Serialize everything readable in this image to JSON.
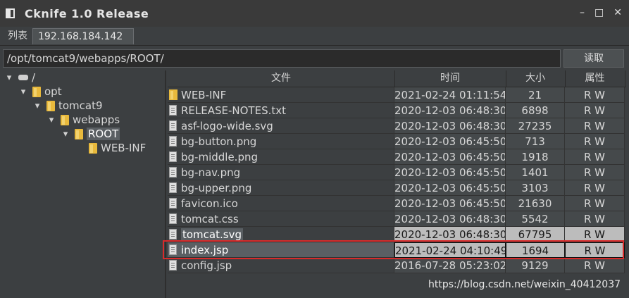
{
  "window": {
    "title": "Cknife 1.0 Release",
    "controls": [
      "–",
      "□",
      "✕"
    ]
  },
  "tabs": [
    {
      "label": "列表"
    },
    {
      "label": "192.168.184.142"
    }
  ],
  "path": {
    "value": "/opt/tomcat9/webapps/ROOT/"
  },
  "read_button": {
    "label": "读取"
  },
  "tree": [
    {
      "label": "/",
      "toggle": "▾",
      "icon": "drive"
    },
    {
      "label": "opt",
      "toggle": "▾",
      "icon": "folder"
    },
    {
      "label": "tomcat9",
      "toggle": "▾",
      "icon": "folder"
    },
    {
      "label": "webapps",
      "toggle": "▾",
      "icon": "folder"
    },
    {
      "label": "ROOT",
      "toggle": "▾",
      "icon": "folder",
      "selected": true
    },
    {
      "label": "WEB-INF",
      "toggle": "",
      "icon": "folder"
    }
  ],
  "table": {
    "headers": [
      "文件",
      "时间",
      "大小",
      "属性"
    ],
    "rows": [
      {
        "name": "WEB-INF",
        "time": "2021-02-24 01:11:54",
        "size": "21",
        "attr": "R W",
        "type": "folder"
      },
      {
        "name": "RELEASE-NOTES.txt",
        "time": "2020-12-03 06:48:30",
        "size": "6898",
        "attr": "R W",
        "type": "file"
      },
      {
        "name": "asf-logo-wide.svg",
        "time": "2020-12-03 06:48:30",
        "size": "27235",
        "attr": "R W",
        "type": "file"
      },
      {
        "name": "bg-button.png",
        "time": "2020-12-03 06:45:50",
        "size": "713",
        "attr": "R W",
        "type": "file"
      },
      {
        "name": "bg-middle.png",
        "time": "2020-12-03 06:45:50",
        "size": "1918",
        "attr": "R W",
        "type": "file"
      },
      {
        "name": "bg-nav.png",
        "time": "2020-12-03 06:45:50",
        "size": "1401",
        "attr": "R W",
        "type": "file"
      },
      {
        "name": "bg-upper.png",
        "time": "2020-12-03 06:45:50",
        "size": "3103",
        "attr": "R W",
        "type": "file"
      },
      {
        "name": "favicon.ico",
        "time": "2020-12-03 06:45:50",
        "size": "21630",
        "attr": "R W",
        "type": "file"
      },
      {
        "name": "tomcat.css",
        "time": "2020-12-03 06:48:30",
        "size": "5542",
        "attr": "R W",
        "type": "file"
      },
      {
        "name": "tomcat.svg",
        "time": "2020-12-03 06:48:30",
        "size": "67795",
        "attr": "R W",
        "type": "file",
        "state": "hl"
      },
      {
        "name": "index.jsp",
        "time": "2021-02-24 04:10:49",
        "size": "1694",
        "attr": "R W",
        "type": "file",
        "state": "sel"
      },
      {
        "name": "config.jsp",
        "time": "2016-07-28 05:23:02",
        "size": "9129",
        "attr": "R W",
        "type": "file"
      }
    ]
  },
  "watermark": "https://blog.csdn.net/weixin_40412037"
}
